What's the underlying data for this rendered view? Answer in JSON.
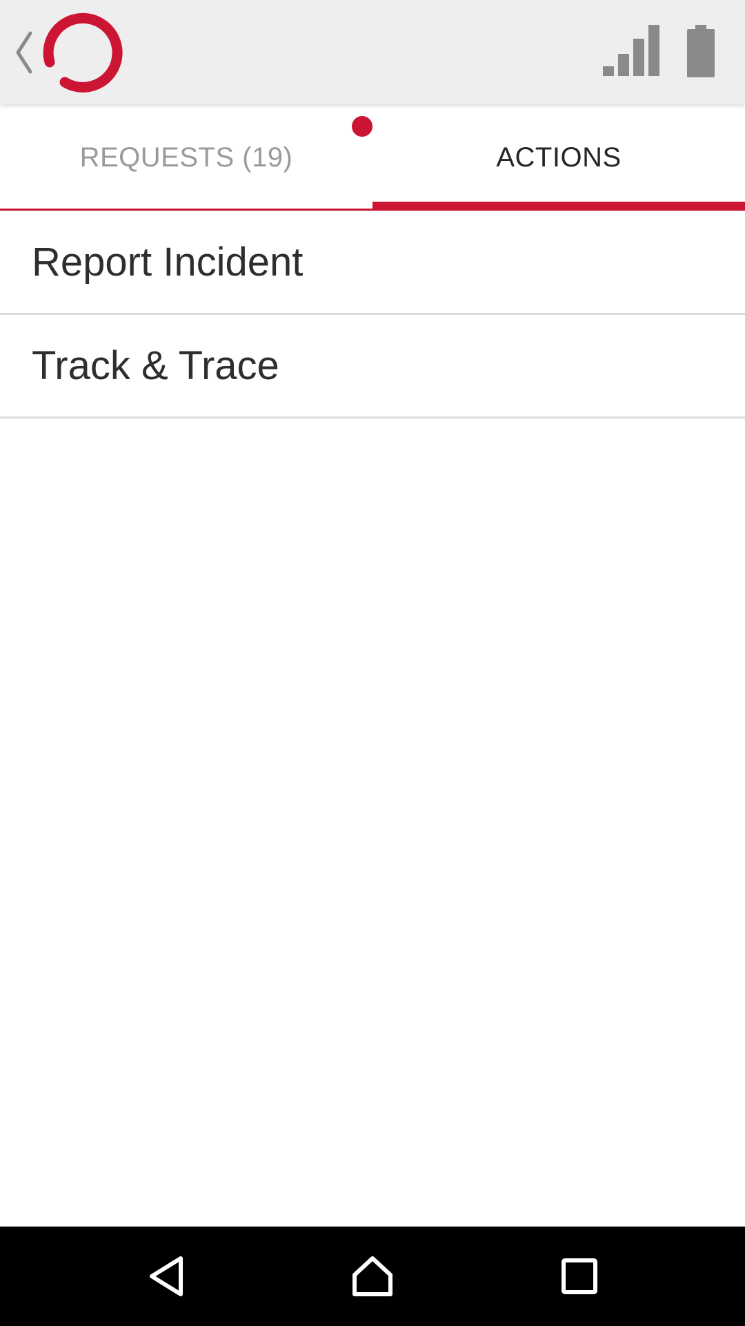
{
  "colors": {
    "accent": "#cc1533",
    "top_bar_bg": "#eeeeee",
    "status_icon": "#8a8a8a",
    "tab_inactive_text": "#9a9a9a",
    "tab_active_text": "#262626",
    "nav_bar_bg": "#000000"
  },
  "top_bar": {
    "back_icon": "chevron-left-icon",
    "logo_icon": "ring-logo-icon",
    "status_icons": [
      "signal-icon",
      "battery-icon"
    ]
  },
  "tabs": [
    {
      "label": "REQUESTS (19)",
      "active": false,
      "has_notification_dot": true
    },
    {
      "label": "ACTIONS",
      "active": true
    }
  ],
  "actions": [
    {
      "label": "Report Incident"
    },
    {
      "label": "Track & Trace"
    }
  ],
  "nav_bar": {
    "buttons": [
      "back-triangle-icon",
      "home-icon",
      "recents-square-icon"
    ]
  }
}
